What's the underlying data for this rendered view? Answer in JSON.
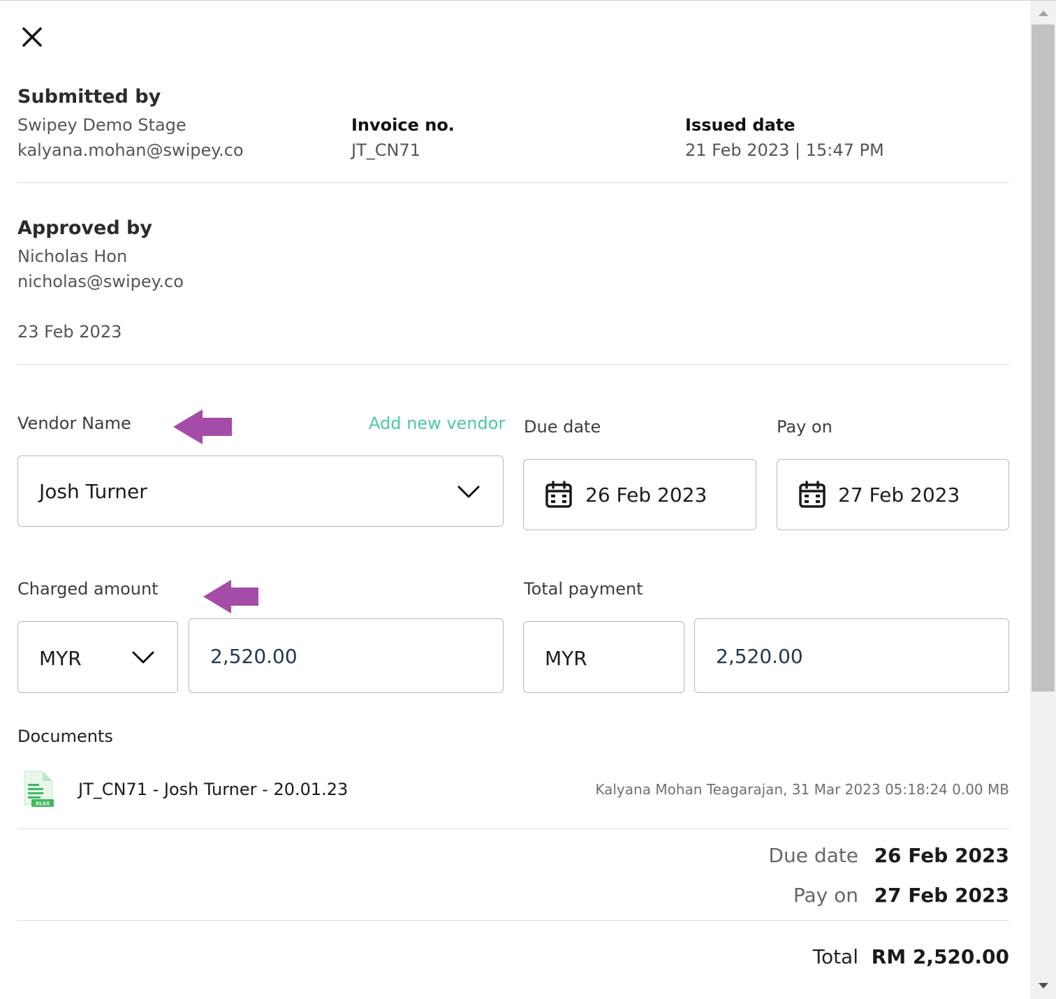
{
  "submitted": {
    "title": "Submitted by",
    "name": "Swipey Demo Stage",
    "email": "kalyana.mohan@swipey.co",
    "invoice_label": "Invoice no.",
    "invoice_value": "JT_CN71",
    "issued_label": "Issued date",
    "issued_value": "21 Feb 2023 | 15:47 PM"
  },
  "approved": {
    "title": "Approved by",
    "name": "Nicholas Hon",
    "email": "nicholas@swipey.co",
    "date": "23 Feb 2023"
  },
  "form": {
    "vendor_label": "Vendor Name",
    "add_vendor_link": "Add new vendor",
    "vendor_value": "Josh Turner",
    "due_label": "Due date",
    "due_value": "26 Feb 2023",
    "pay_label": "Pay on",
    "pay_value": "27 Feb 2023",
    "charged_label": "Charged amount",
    "charged_currency": "MYR",
    "charged_amount": "2,520.00",
    "total_label": "Total payment",
    "total_currency": "MYR",
    "total_amount": "2,520.00"
  },
  "documents": {
    "title": "Documents",
    "items": [
      {
        "name": "JT_CN71 - Josh Turner - 20.01.23",
        "meta": "Kalyana Mohan Teagarajan, 31 Mar 2023 05:18:24 0.00 MB",
        "icon": "xlsx-file-icon",
        "icon_text": "XLSX"
      }
    ]
  },
  "summary": {
    "due_label": "Due date",
    "due_value": "26 Feb 2023",
    "pay_label": "Pay on",
    "pay_value": "27 Feb 2023",
    "total_label": "Total",
    "total_value": "RM 2,520.00"
  },
  "colors": {
    "accent_green": "#4cc9a0",
    "annotation_arrow": "#a54ba8"
  }
}
